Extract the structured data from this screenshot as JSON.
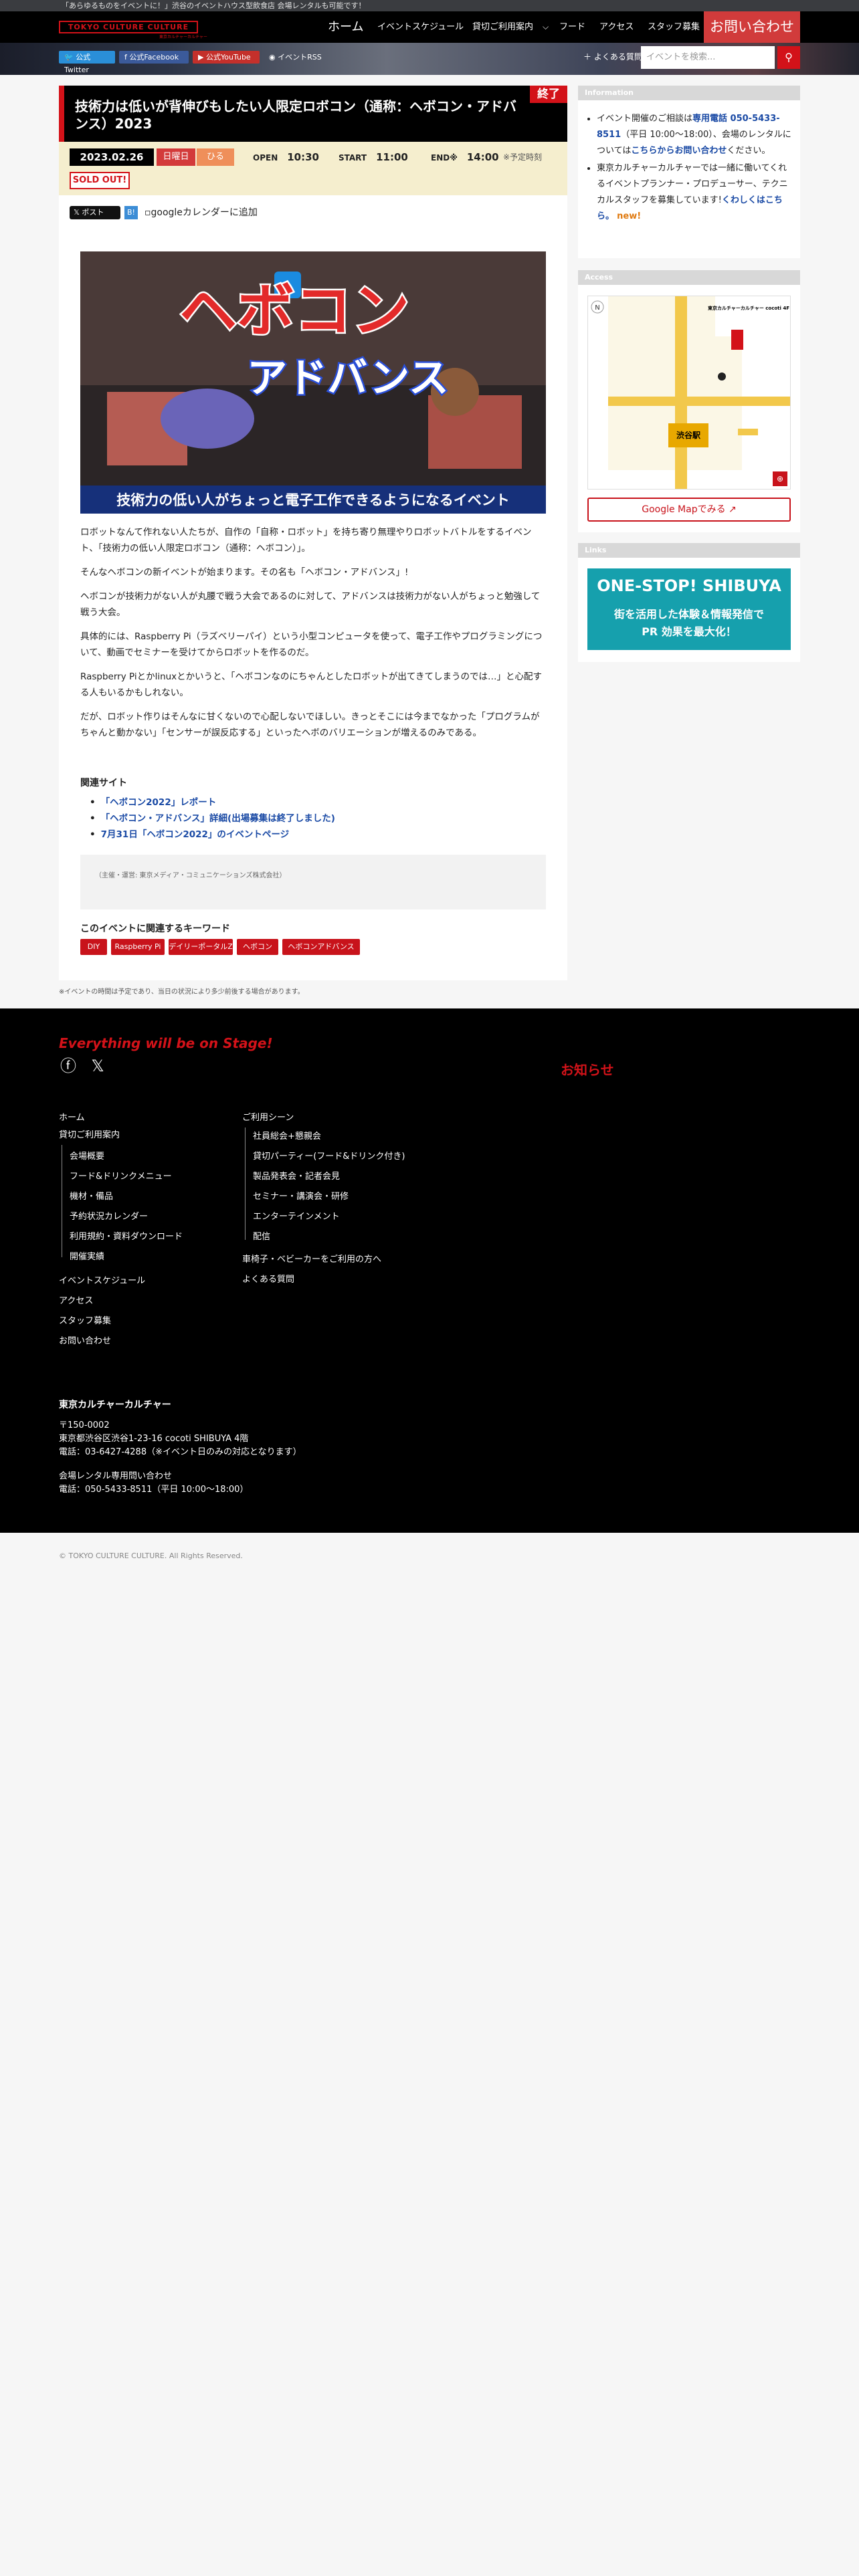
{
  "topbar": {
    "tagline": "「あらゆるものをイベントに！」渋谷のイベントハウス型飲食店 会場レンタルも可能です！"
  },
  "header": {
    "logo": "TOKYO CULTURE CULTURE",
    "logo_sub": "東京カルチャーカルチャー",
    "nav": [
      "ホーム",
      "イベントスケジュール",
      "貸切ご利用案内",
      "フード",
      "アクセス",
      "スタッフ募集"
    ],
    "contact": "お問い合わせ"
  },
  "social": {
    "twitter": "公式Twitter",
    "facebook": "公式Facebook",
    "youtube": "公式YouTube",
    "rss": "イベントRSS",
    "faq": "よくある質問",
    "search_placeholder": "イベントを検索..."
  },
  "event": {
    "title": "技術力は低いが背伸びもしたい人限定ロボコン（通称：ヘボコン・アドバンス）2023",
    "status": "終了",
    "date": "2023.02.26",
    "day": "日曜日",
    "period": "ひる",
    "open_label": "OPEN",
    "open": "10:30",
    "start_label": "START",
    "start": "11:00",
    "end_label": "END※",
    "end": "14:00",
    "end_note": "※予定時刻",
    "soldout": "SOLD OUT!",
    "share_x": "ポスト",
    "share_hatena": "B!",
    "gcal": "googleカレンダーに追加",
    "hero_title": "ヘボコン",
    "hero_sub": "アドバンス",
    "hero_caption": "技術力の低い人がちょっと電子工作できるようになるイベント",
    "p1": "ロボットなんて作れない人たちが、自作の「自称・ロボット」を持ち寄り無理やりロボットバトルをするイベント、「技術力の低い人限定ロボコン（通称：ヘボコン）」。",
    "p2": "そんなヘボコンの新イベントが始まります。その名も「ヘボコン・アドバンス」!",
    "p3": "ヘボコンが技術力がない人が丸腰で戦う大会であるのに対して、アドバンスは技術力がない人がちょっと勉強して戦う大会。",
    "p4": "具体的には、Raspberry Pi（ラズベリーパイ）という小型コンピュータを使って、電子工作やプログラミングについて、動画でセミナーを受けてからロボットを作るのだ。",
    "p5": "Raspberry Piとかlinuxとかいうと、「ヘボコンなのにちゃんとしたロボットが出てきてしまうのでは…」と心配する人もいるかもしれない。",
    "p6": "だが、ロボット作りはそんなに甘くないので心配しないでほしい。きっとそこには今までなかった「プログラムがちゃんと動かない」「センサーが誤反応する」といったヘボのバリエーションが増えるのみである。",
    "related_title": "関連サイト",
    "related": [
      "「ヘボコン2022」レポート",
      "「ヘボコン・アドバンス」詳細(出場募集は終了しました)",
      "7月31日「ヘボコン2022」のイベントページ"
    ],
    "credit": "（主催・運営: 東京メディア・コミュニケーションズ株式会社）",
    "keywords_title": "このイベントに関連するキーワード",
    "keywords": [
      "DIY",
      "Raspberry Pi",
      "デイリーポータルZ",
      "ヘボコン",
      "ヘボコンアドバンス"
    ]
  },
  "footnote": "※イベントの時間は予定であり、当日の状況により多少前後する場合があります。",
  "sidebar": {
    "info_title": "Information",
    "info1_a": "イベント開催のご相談は",
    "info1_b": "専用電話 050-5433-8511",
    "info1_c": "（平日 10:00〜18:00）、会場のレンタルについては",
    "info1_d": "こちらからお問い合わせ",
    "info1_e": "ください。",
    "info2_a": "東京カルチャーカルチャーでは一緒に働いてくれるイベントプランナー・プロデューサー、テクニカルスタッフを募集しています!",
    "info2_b": "くわしくはこちら。",
    "info2_new": "new!",
    "access_title": "Access",
    "map_label_venue": "東京カルチャーカルチャー cocoti 4F",
    "map_label_station": "渋谷駅",
    "map_btn": "Google Mapでみる",
    "links_title": "Links",
    "banner_h": "ONE-STOP! SHIBUYA",
    "banner_s1": "街を活用した体験＆情報発信で",
    "banner_s2": "PR 効果を最大化！"
  },
  "footer": {
    "slogan": "Everything will be on Stage!",
    "news": "お知らせ",
    "col1": [
      "ホーム",
      "貸切ご利用案内"
    ],
    "col1_sub": [
      "会場概要",
      "フード&ドリンクメニュー",
      "機材・備品",
      "予約状況カレンダー",
      "利用規約・資料ダウンロード",
      "開催実績"
    ],
    "col1_tail": [
      "イベントスケジュール",
      "アクセス",
      "スタッフ募集",
      "お問い合わせ"
    ],
    "col2_title": "ご利用シーン",
    "col2_sub": [
      "社員総会+懇親会",
      "貸切パーティー(フード&ドリンク付き)",
      "製品発表会・記者会見",
      "セミナー・講演会・研修",
      "エンターテインメント",
      "配信"
    ],
    "col2_tail": [
      "車椅子・ベビーカーをご利用の方へ",
      "よくある質問"
    ],
    "company": "東京カルチャーカルチャー",
    "addr1": "〒150-0002",
    "addr2": "東京都渋谷区渋谷1-23-16 cocoti SHIBUYA 4階",
    "addr3": "電話：03-6427-4288（※イベント日のみの対応となります）",
    "rent1": "会場レンタル専用問い合わせ",
    "rent2": "電話：050-5433-8511（平日 10:00〜18:00）",
    "copyright": "© TOKYO CULTURE CULTURE. All Rights Reserved."
  }
}
